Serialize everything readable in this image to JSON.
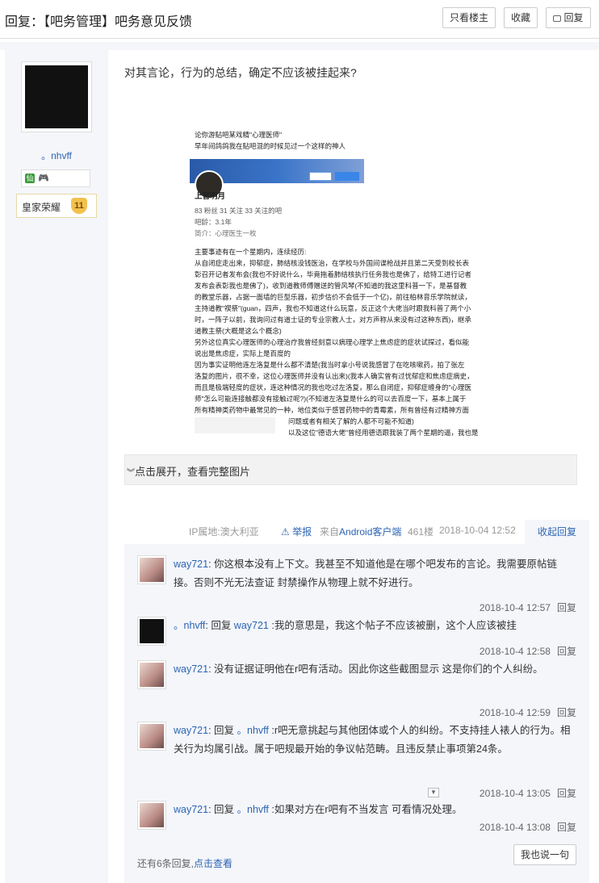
{
  "header": {
    "title": "回复：【吧务管理】吧务意见反馈",
    "only_op_label": "只看楼主",
    "favorite_label": "收藏",
    "reply_label": "回复"
  },
  "author": {
    "name": "。nhvff",
    "badge_title": "皇家荣耀",
    "badge_level": "11"
  },
  "post": {
    "text": "对其言论，行为的总结，确定不应该被挂起来?",
    "expand_label": "点击展开，查看完整图片",
    "image_lines": [
      "论你游贴吧某戏精\"心理医师\"",
      "早年间鸽鸽我在贴吧混的时候见过一个这样的神人",
      "上官明月",
      "83 粉丝    31 关注    33 关注的吧",
      "吧龄：3.1年",
      "简介：心理医生一枚",
      "主要事迹有在一个星期内，连续经历:",
      "从自闭症走出来，抑郁症，肺结核没钱医治，在学校与外国间谍枪战并且第二天受到校长表",
      "彰召开记者发布会(我也不好说什么，毕竟拖着肺结核执行任务我也是佛了，给特工进行记者",
      "发布会表彰我也是佛了)，收到道教师傅赠送的管风琴(不知道的我这里科普一下，是基督教",
      "的教堂乐器，占据一面墙的巨型乐器，初步估价不会低于一个亿)，前往柏林音乐学院就读，",
      "主持道教\"禊祭\"(guan，四声，我也不知道这什么玩意，反正这个大佬当时跟我科普了两个小",
      "时，一阵子以前，我询问过有道士证的专业宗教人士，对方声称从来没有过这种东西)，继承",
      "道教主祭(大概是这么个概念)",
      "另外这位真实心理医师的心理治疗我曾经刻意以病理心理学上焦虑症的症状试探过，看似能",
      "说出是焦虑症，实际上是百度的",
      "因为事实证明他连左洛复是什么都不清楚(我当时拿小号说我感冒了在吃咳嗽药，拍了张左",
      "洛复的图片，很不幸，这位心理医师并没有认出来)(我本人确实曾有过忧郁症和焦虑症病史，",
      "而且是极端轻度的症状，连这种情况的我也吃过左洛复，那么自闭症，抑郁症缠身的\"心理医",
      "师\"怎么可能连接触都没有接触过呢?)(不知道左洛复是什么的可以去百度一下，基本上属于",
      "所有精神类药物中最常见的一种，地位类似于感冒药物中的青霉素，所有曾经有过精神方面",
      "问题或者有相关了解的人都不可能不知道)",
      "以及这位\"德语大佬\"曾经用德语跟我装了两个星期的逼，我也是"
    ]
  },
  "meta": {
    "ip": "IP属地:澳大利亚",
    "report": "举报",
    "client": "来自Android客户端",
    "floor": "461楼",
    "time": "2018-10-04 12:52",
    "collapse": "收起回复"
  },
  "comments": [
    {
      "user": "way721",
      "text": ": 你这根本没有上下文。我甚至不知道他是在哪个吧发布的言论。我需要原帖链接。否则不光无法查证 封禁操作从物理上就不好进行。",
      "time": "2018-10-4 12:57",
      "reply": "回复"
    },
    {
      "user": "。nhvff",
      "prefix": ": 回复 ",
      "target": "way721",
      "text": " :我的意思是，我这个帖子不应该被删，这个人应该被挂",
      "time": "2018-10-4 12:58",
      "reply": "回复"
    },
    {
      "user": "way721",
      "text": ": 没有证据证明他在r吧有活动。因此你这些截图显示 这是你们的个人纠纷。",
      "time": "2018-10-4 12:59",
      "reply": "回复"
    },
    {
      "user": "way721",
      "prefix": ": 回复 ",
      "target": "。nhvff",
      "text": " :r吧无意挑起与其他团体或个人的纠纷。不支持挂人裱人的行为。相关行为均属引战。属于吧规最开始的争议帖范畴。且违反禁止事项第24条。",
      "time": "2018-10-4 13:05",
      "reply": "回复"
    },
    {
      "user": "way721",
      "prefix": ": 回复 ",
      "target": "。nhvff",
      "text": " :如果对方在r吧有不当发言 可看情况处理。",
      "time": "2018-10-4 13:08",
      "reply": "回复"
    }
  ],
  "footer": {
    "more_prefix": "还有6条回复,",
    "more_link": "点击查看",
    "say_button": "我也说一句"
  }
}
